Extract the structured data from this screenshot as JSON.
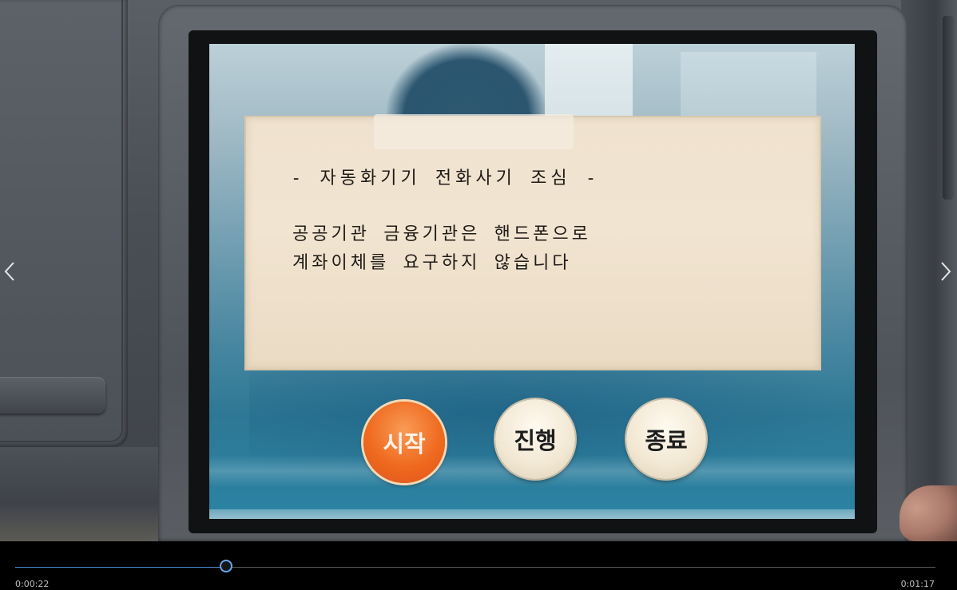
{
  "notice": {
    "title": "- 자동화기기 전화사기 조심 -",
    "line1": "공공기관 금융기관은 핸드폰으로",
    "line2": "계좌이체를 요구하지 않습니다"
  },
  "buttons": {
    "start": "시작",
    "proceed": "진행",
    "end": "종료"
  },
  "player": {
    "current_time": "0:00:22",
    "total_time": "0:01:17",
    "progress": 0.229
  },
  "nav": {
    "prev_icon": "chevron-left-icon",
    "next_icon": "chevron-right-icon"
  },
  "colors": {
    "start_button": "#ef6a1f",
    "notice_background": "#f1e4d0",
    "seek_accent": "#4d8fd6"
  }
}
